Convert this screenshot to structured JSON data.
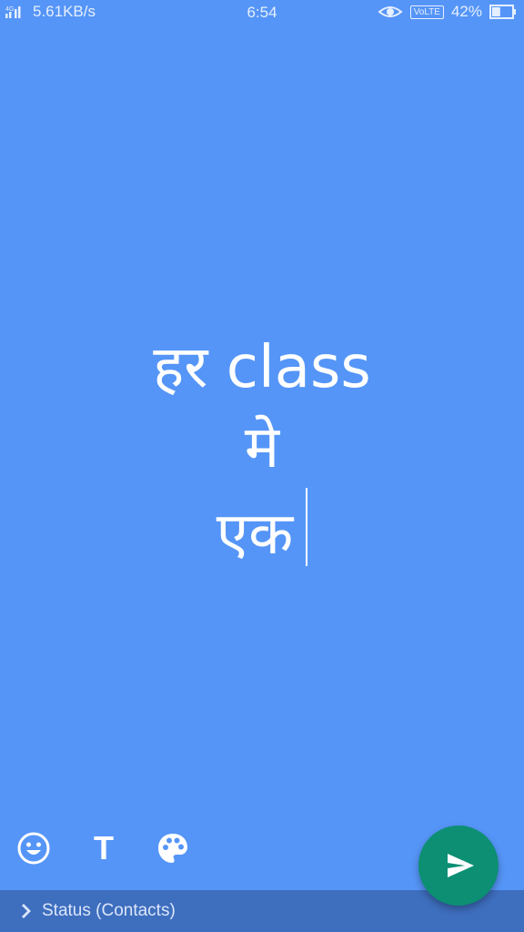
{
  "status_bar": {
    "network_speed": "5.61KB/s",
    "time": "6:54",
    "volte": "VoLTE",
    "battery_percent": "42%",
    "battery_level": 0.42
  },
  "composer": {
    "text_lines": [
      "हर class",
      "मे",
      "एक"
    ],
    "background_color": "#5595f7",
    "text_color": "#ffffff"
  },
  "tools": {
    "emoji": "smiley-icon",
    "text": "T",
    "palette": "palette-icon"
  },
  "send_button": {
    "icon": "send-icon",
    "color": "#0c8f73"
  },
  "recipient_bar": {
    "label": "Status (Contacts)"
  }
}
